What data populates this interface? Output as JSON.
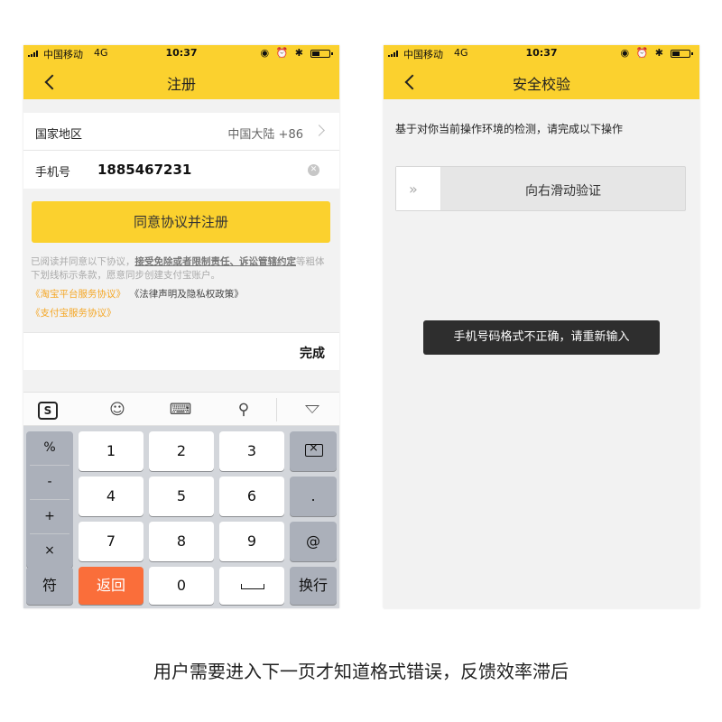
{
  "status_bar": {
    "carrier": "中国移动",
    "network": "4G",
    "time": "10:37",
    "icons": "◉ ⏰ ✱"
  },
  "left_screen": {
    "title": "注册",
    "country_label": "国家地区",
    "country_value": "中国大陆 +86",
    "phone_label": "手机号",
    "phone_value": "1885467231",
    "submit_label": "同意协议并注册",
    "agreement_prefix": "已阅读并同意以下协议，",
    "agreement_bold": "接受免除或者限制责任、诉讼管辖约定",
    "agreement_suffix": "等粗体下划线标示条款，愿意同步创建支付宝账户。",
    "link_taobao": "《淘宝平台服务协议》",
    "link_legal": "《法律声明及隐私权政策》",
    "link_alipay": "《支付宝服务协议》",
    "keyboard": {
      "done_label": "完成",
      "toolbar": {
        "sogou": "S",
        "emoji": "☺",
        "keyboard": "⌨",
        "search": "⚲"
      },
      "symbols": [
        "%",
        "-",
        "+",
        "×"
      ],
      "digits": [
        "1",
        "2",
        "3",
        "4",
        "5",
        "6",
        "7",
        "8",
        "9",
        "0"
      ],
      "dot": ".",
      "at": "@",
      "symbol_key": "符",
      "return_key": "返回",
      "newline_key": "换行"
    }
  },
  "right_screen": {
    "title": "安全校验",
    "instruction": "基于对你当前操作环境的检测，请完成以下操作",
    "slider_handle": "»",
    "slider_text": "向右滑动验证",
    "toast": "手机号码格式不正确，请重新输入"
  },
  "caption": "用户需要进入下一页才知道格式错误，反馈效率滞后",
  "colors": {
    "brand_yellow": "#fbd12e",
    "link_orange": "#f5a623",
    "key_orange": "#fa6e3a",
    "toast_bg": "#2e2e2e"
  },
  "icons": [
    "back-arrow-icon",
    "chevron-right-icon",
    "clear-icon",
    "sogou-icon",
    "emoji-icon",
    "keyboard-icon",
    "search-icon",
    "collapse-icon",
    "backspace-icon",
    "space-icon",
    "slider-arrows-icon"
  ]
}
